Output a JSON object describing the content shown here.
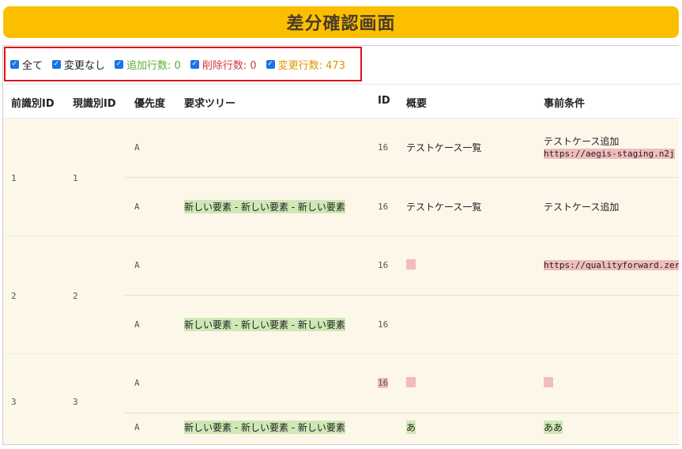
{
  "title": "差分確認画面",
  "filters": [
    {
      "label": "全て"
    },
    {
      "label": "変更なし"
    },
    {
      "label": "追加行数: 0"
    },
    {
      "label": "削除行数: 0"
    },
    {
      "label": "変更行数: 473"
    }
  ],
  "columns": [
    "前識別ID",
    "現識別ID",
    "優先度",
    "要求ツリー",
    "ID",
    "概要",
    "事前条件"
  ],
  "groups": [
    {
      "prev_id": "1",
      "curr_id": "1",
      "rows": [
        {
          "priority": "A",
          "tree": "",
          "id": "16",
          "summary": "テストケース一覧",
          "precondition": "テストケース追加",
          "precondition_url": "https://aegis-staging.n2j"
        },
        {
          "priority": "A",
          "tree": "新しい要素 - 新しい要素 - 新しい要素",
          "id": "16",
          "summary": "テストケース一覧",
          "precondition": "テストケース追加"
        }
      ]
    },
    {
      "prev_id": "2",
      "curr_id": "2",
      "rows": [
        {
          "priority": "A",
          "tree": "",
          "id": "16",
          "summary": "",
          "precondition_url": "https://qualityforward.zer"
        },
        {
          "priority": "A",
          "tree": "新しい要素 - 新しい要素 - 新しい要素",
          "id": "16",
          "summary": "",
          "precondition": ""
        }
      ]
    },
    {
      "prev_id": "3",
      "curr_id": "3",
      "rows": [
        {
          "priority": "A",
          "tree": "",
          "id": "16",
          "summary": "",
          "precondition": ""
        },
        {
          "priority": "A",
          "tree": "新しい要素 - 新しい要素 - 新しい要素",
          "id": "",
          "summary": "あ",
          "precondition": "ああ"
        }
      ]
    }
  ],
  "colors": {
    "banner": "#fbbf00",
    "added": "#5fae2e",
    "deleted": "#d43a3a",
    "changed": "#e09400",
    "row_bg": "#fdf7ea"
  }
}
